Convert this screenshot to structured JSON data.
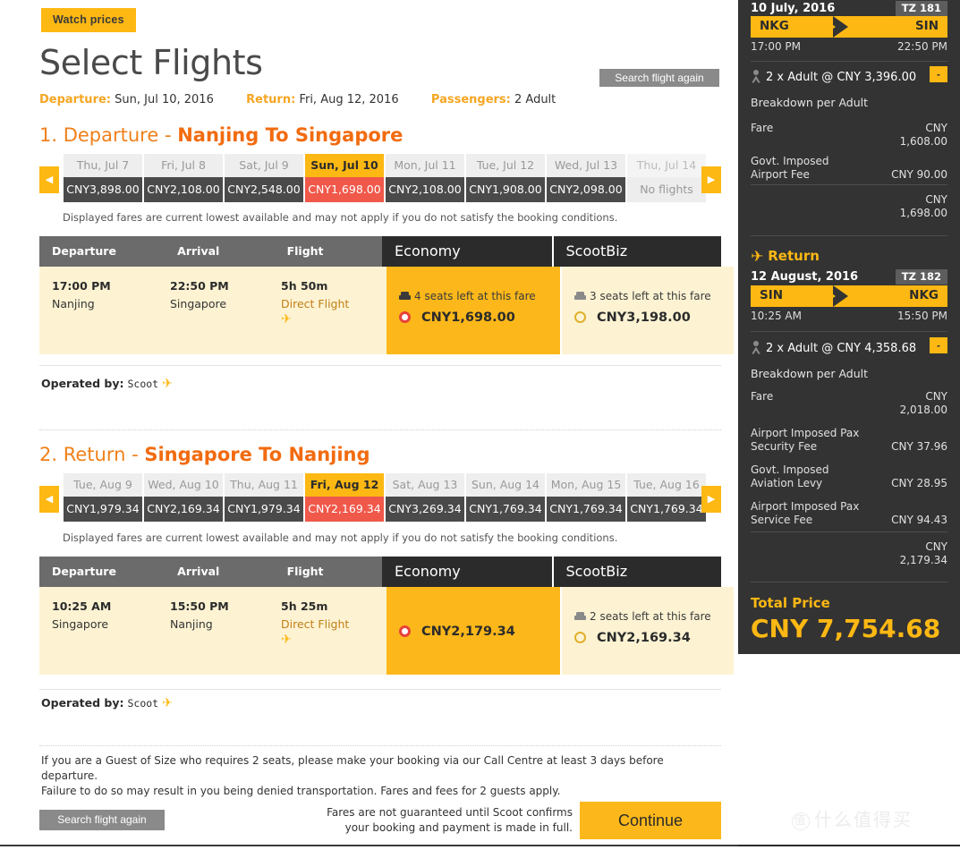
{
  "header": {
    "watch_prices": "Watch prices",
    "title": "Select Flights",
    "search_again": "Search flight again",
    "departure_label": "Departure:",
    "departure_value": "Sun, Jul 10, 2016",
    "return_label": "Return:",
    "return_value": "Fri, Aug 12, 2016",
    "passengers_label": "Passengers:",
    "passengers_value": "2 Adult"
  },
  "legs": [
    {
      "heading_num": "1. Departure - ",
      "heading_route": "Nanjing To Singapore",
      "days": [
        {
          "date": "Thu, Jul 7",
          "fare": "CNY3,898.00",
          "state": "normal"
        },
        {
          "date": "Fri, Jul 8",
          "fare": "CNY2,108.00",
          "state": "normal"
        },
        {
          "date": "Sat, Jul 9",
          "fare": "CNY2,548.00",
          "state": "normal"
        },
        {
          "date": "Sun, Jul 10",
          "fare": "CNY1,698.00",
          "state": "selected"
        },
        {
          "date": "Mon, Jul 11",
          "fare": "CNY2,108.00",
          "state": "normal"
        },
        {
          "date": "Tue, Jul 12",
          "fare": "CNY1,908.00",
          "state": "normal"
        },
        {
          "date": "Wed, Jul 13",
          "fare": "CNY2,098.00",
          "state": "normal"
        },
        {
          "date": "Thu, Jul 14",
          "fare": "No flights",
          "state": "none"
        }
      ],
      "fare_note": "Displayed fares are current lowest available and may not apply if you do not satisfy the booking conditions.",
      "columns": {
        "departure": "Departure",
        "arrival": "Arrival",
        "flight": "Flight",
        "economy": "Economy",
        "scootbiz": "ScootBiz"
      },
      "row": {
        "dep_time": "17:00 PM",
        "dep_city": "Nanjing",
        "arr_time": "22:50 PM",
        "arr_city": "Singapore",
        "duration": "5h 50m",
        "direct": "Direct Flight"
      },
      "economy": {
        "seats": "4 seats left at this fare",
        "price": "CNY1,698.00",
        "selected": true
      },
      "scootbiz": {
        "seats": "3 seats left at this fare",
        "price": "CNY3,198.00",
        "selected": false
      },
      "operated_label": "Operated by:",
      "operated_value": "Scoot"
    },
    {
      "heading_num": "2. Return - ",
      "heading_route": "Singapore To Nanjing",
      "days": [
        {
          "date": "Tue, Aug 9",
          "fare": "CNY1,979.34",
          "state": "normal"
        },
        {
          "date": "Wed, Aug 10",
          "fare": "CNY2,169.34",
          "state": "normal"
        },
        {
          "date": "Thu, Aug 11",
          "fare": "CNY1,979.34",
          "state": "normal"
        },
        {
          "date": "Fri, Aug 12",
          "fare": "CNY2,169.34",
          "state": "selected"
        },
        {
          "date": "Sat, Aug 13",
          "fare": "CNY3,269.34",
          "state": "normal"
        },
        {
          "date": "Sun, Aug 14",
          "fare": "CNY1,769.34",
          "state": "normal"
        },
        {
          "date": "Mon, Aug 15",
          "fare": "CNY1,769.34",
          "state": "normal"
        },
        {
          "date": "Tue, Aug 16",
          "fare": "CNY1,769.34",
          "state": "normal"
        }
      ],
      "fare_note": "Displayed fares are current lowest available and may not apply if you do not satisfy the booking conditions.",
      "columns": {
        "departure": "Departure",
        "arrival": "Arrival",
        "flight": "Flight",
        "economy": "Economy",
        "scootbiz": "ScootBiz"
      },
      "row": {
        "dep_time": "10:25 AM",
        "dep_city": "Singapore",
        "arr_time": "15:50 PM",
        "arr_city": "Nanjing",
        "duration": "5h 25m",
        "direct": "Direct Flight"
      },
      "economy": {
        "seats": "",
        "price": "CNY2,179.34",
        "selected": true
      },
      "scootbiz": {
        "seats": "2 seats left at this fare",
        "price": "CNY2,169.34",
        "selected": false
      },
      "operated_label": "Operated by:",
      "operated_value": "Scoot"
    }
  ],
  "footer": {
    "guest_of_size_line1": "If you are a Guest of Size who requires 2 seats, please make your booking via our Call Centre at least 3 days before departure.",
    "guest_of_size_line2": "Failure to do so may result in you being denied transportation. Fares and fees for 2 guests apply.",
    "search_again": "Search flight again",
    "guarantee_line1": "Fares are not guaranteed until Scoot confirms",
    "guarantee_line2": "your booking and payment is made in full.",
    "continue": "Continue"
  },
  "sidebar": {
    "outbound": {
      "date": "10 July, 2016",
      "flight_no": "TZ 181",
      "from": "NKG",
      "to": "SIN",
      "dep_time": "17:00 PM",
      "arr_time": "22:50 PM",
      "pax": "2 x Adult @ CNY 3,396.00",
      "minus": "-",
      "breakdown_label": "Breakdown per Adult",
      "lines": [
        {
          "label": "Fare",
          "value": "CNY\n1,608.00"
        },
        {
          "label": "Govt. Imposed Airport Fee",
          "value": "CNY 90.00"
        }
      ],
      "subtotal": "CNY\n1,698.00"
    },
    "return": {
      "title": "Return",
      "date": "12 August, 2016",
      "flight_no": "TZ 182",
      "from": "SIN",
      "to": "NKG",
      "dep_time": "10:25 AM",
      "arr_time": "15:50 PM",
      "pax": "2 x Adult @ CNY 4,358.68",
      "minus": "-",
      "breakdown_label": "Breakdown per Adult",
      "lines": [
        {
          "label": "Fare",
          "value": "CNY\n2,018.00"
        },
        {
          "label": "Airport Imposed Pax Security Fee",
          "value": "CNY 37.96"
        },
        {
          "label": "Govt. Imposed Aviation Levy",
          "value": "CNY 28.95"
        },
        {
          "label": "Airport Imposed Pax Service Fee",
          "value": "CNY 94.43"
        }
      ],
      "subtotal": "CNY\n2,179.34"
    },
    "total_label": "Total Price",
    "total_value": "CNY 7,754.68"
  },
  "watermark": {
    "mark": "值",
    "text": "什么值得买"
  },
  "colors": {
    "brand_yellow": "#fdb813",
    "economy_yellow": "#fcb81a",
    "cream": "#fdf3d3",
    "selected_red": "#f0584a",
    "dark_header": "#2b2b2b",
    "grey_header": "#6b6b6b",
    "sidebar_bg": "#333333",
    "orange_title": "#f0801a"
  }
}
